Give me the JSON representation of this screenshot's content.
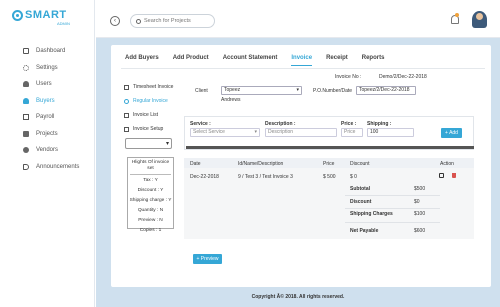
{
  "logo": {
    "text": "SMART",
    "sub": "ADMIN"
  },
  "sidebar": {
    "items": [
      {
        "label": "Dashboard",
        "icon": "dashboard-icon"
      },
      {
        "label": "Settings",
        "icon": "gear-icon"
      },
      {
        "label": "Users",
        "icon": "users-icon"
      },
      {
        "label": "Buyers",
        "icon": "buyers-icon",
        "active": true
      },
      {
        "label": "Payroll",
        "icon": "payroll-icon"
      },
      {
        "label": "Projects",
        "icon": "projects-icon"
      },
      {
        "label": "Vendors",
        "icon": "vendors-icon"
      },
      {
        "label": "Announcements",
        "icon": "announcement-icon"
      }
    ]
  },
  "topbar": {
    "back_symbol": "‹",
    "search_placeholder": "Search for Projects"
  },
  "tabs": [
    "Add Buyers",
    "Add Product",
    "Account Statement",
    "Invoice",
    "Receipt",
    "Reports"
  ],
  "active_tab": "Invoice",
  "left_menu": [
    {
      "label": "Timesheet Invoice"
    },
    {
      "label": "Regular Invoice",
      "active": true
    },
    {
      "label": "Invoice List"
    },
    {
      "label": "Invoice Setup"
    }
  ],
  "settings_box": {
    "title": "Hlights Of invoice set",
    "rows": [
      "Tax : Y",
      "Discount : Y",
      "Shipping charge : Y",
      "Quantity : N",
      "Preview : N",
      "Copies : 1"
    ]
  },
  "invoice": {
    "invoice_no_label": "Invoice No :",
    "invoice_no": "Demo/2/Dec-22-2018",
    "client_label": "Client",
    "client_value": "Topeez",
    "client_name": "Andrews",
    "po_label": "P.O.Number/Date",
    "po_value": "Topeez/2/Dec-22-2018"
  },
  "service_form": {
    "service_label": "Service :",
    "service_placeholder": "Select Service",
    "description_label": "Description :",
    "description_placeholder": "Description",
    "price_label": "Price :",
    "price_placeholder": "Price",
    "shipping_label": "Shipping :",
    "shipping_value": "100",
    "add_button": "+ Add"
  },
  "table": {
    "headers": [
      "Date",
      "Id/Name/Description",
      "Price",
      "Discount",
      "Action"
    ],
    "rows": [
      {
        "date": "Dec-22-2018",
        "desc": "9 / Test 3 / Test Invoice 3",
        "price": "$ 500",
        "discount": "$ 0"
      }
    ],
    "summary": [
      {
        "label": "Subtotal",
        "value": "$500"
      },
      {
        "label": "Discount",
        "value": "$0"
      },
      {
        "label": "Shipping Charges",
        "value": "$100"
      },
      {
        "label": "Net Payable",
        "value": "$600"
      }
    ]
  },
  "preview_button": "+ Preview",
  "footer": "Copyright Â© 2018. All rights reserved."
}
